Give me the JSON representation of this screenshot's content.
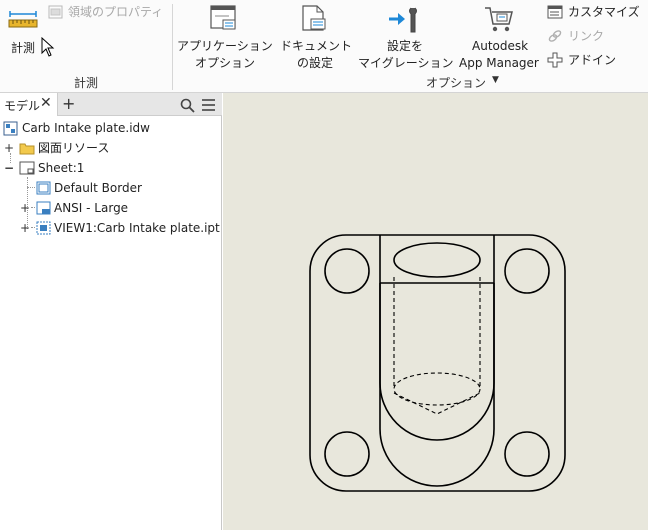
{
  "ribbon": {
    "measure_label": "計測",
    "region_props_label": "領域のプロパティ",
    "measure_group_label": "計測",
    "app_options_label_line1": "アプリケーション",
    "app_options_label_line2": "オプション",
    "doc_settings_label_line1": "ドキュメント",
    "doc_settings_label_line2": "の設定",
    "migrate_label_line1": "設定を",
    "migrate_label_line2": "マイグレーション",
    "app_manager_label_line1": "Autodesk",
    "app_manager_label_line2": "App Manager",
    "customize_label": "カスタマイズ",
    "link_label": "リンク",
    "addin_label": "アドイン",
    "options_group_label": "オプション",
    "options_group_arrow": "▼"
  },
  "browser": {
    "tab_label": "モデル",
    "tab_close": "✕",
    "tab_add": "+",
    "tree": {
      "root": "Carb Intake plate.idw",
      "resources": "図面リソース",
      "sheet": "Sheet:1",
      "border": "Default Border",
      "titleblock": "ANSI - Large",
      "view": "VIEW1:Carb Intake plate.ipt",
      "expander_plus": "+",
      "expander_minus": "−"
    }
  },
  "colors": {
    "ribbon_bg": "#fbfbfb",
    "canvas_bg": "#e8e7dc",
    "accent_blue": "#1e88d7",
    "disabled_text": "#a8a8a8"
  },
  "icons": {
    "measure": "ruler-icon",
    "region_props": "region-properties-icon",
    "app_options": "application-options-icon",
    "doc_settings": "document-settings-icon",
    "migrate": "migrate-settings-icon",
    "app_manager": "app-manager-cart-icon",
    "customize": "customize-icon",
    "link": "link-icon",
    "addin": "addin-icon",
    "search": "search-icon",
    "menu": "hamburger-menu-icon"
  }
}
